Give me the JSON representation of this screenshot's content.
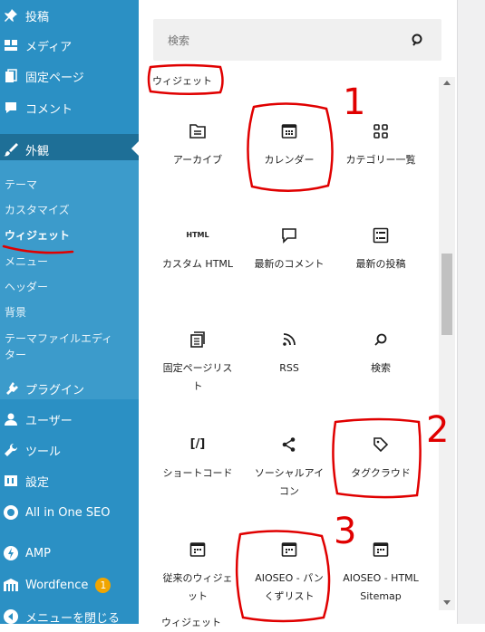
{
  "sidebar": {
    "items": [
      {
        "label": "投稿",
        "icon": "pin-icon"
      },
      {
        "label": "メディア",
        "icon": "media-icon"
      },
      {
        "label": "固定ページ",
        "icon": "pages-icon"
      },
      {
        "label": "コメント",
        "icon": "comment-icon"
      },
      {
        "label": "外観",
        "icon": "brush-icon"
      },
      {
        "label": "プラグイン",
        "icon": "plugin-icon"
      },
      {
        "label": "ユーザー",
        "icon": "user-icon"
      },
      {
        "label": "ツール",
        "icon": "wrench-icon"
      },
      {
        "label": "設定",
        "icon": "settings-icon"
      },
      {
        "label": "All in One SEO",
        "icon": "aioseo-icon"
      },
      {
        "label": "AMP",
        "icon": "amp-icon"
      },
      {
        "label": "Wordfence",
        "icon": "wordfence-icon",
        "badge": "1"
      },
      {
        "label": "メニューを閉じる",
        "icon": "collapse-icon"
      }
    ],
    "appearance_sub": [
      "テーマ",
      "カスタマイズ",
      "ウィジェット",
      "メニュー",
      "ヘッダー",
      "背景",
      "テーマファイルエディ",
      "ター"
    ]
  },
  "inserter": {
    "search_placeholder": "検索",
    "category": "ウィジェット",
    "blocks": [
      {
        "label": "アーカイブ",
        "icon": "archive-icon"
      },
      {
        "label": "カレンダー",
        "icon": "calendar-icon"
      },
      {
        "label": "カテゴリー一覧",
        "icon": "categories-icon"
      },
      {
        "label": "カスタム HTML",
        "icon": "html-icon",
        "icon_text": "HTML"
      },
      {
        "label": "最新のコメント",
        "icon": "latest-comments-icon"
      },
      {
        "label": "最新の投稿",
        "icon": "latest-posts-icon"
      },
      {
        "label": "固定ページリスト",
        "icon": "page-list-icon"
      },
      {
        "label": "RSS",
        "icon": "rss-icon"
      },
      {
        "label": "検索",
        "icon": "search-block-icon"
      },
      {
        "label": "ショートコード",
        "icon": "shortcode-icon",
        "icon_text": "[/]"
      },
      {
        "label": "ソーシャルアイコン",
        "icon": "share-icon"
      },
      {
        "label": "タグクラウド",
        "icon": "tag-icon"
      },
      {
        "label": "従来のウィジェット",
        "icon": "legacy-widget-icon"
      },
      {
        "label": "AIOSEO - パンくずリスト",
        "icon": "aioseo-breadcrumb-icon"
      },
      {
        "label": "AIOSEO - HTML Sitemap",
        "icon": "aioseo-sitemap-icon"
      }
    ],
    "next_category": "ウィジェット"
  },
  "annotations": {
    "n1": "1",
    "n2": "2",
    "n3": "3",
    "color": "#e00000"
  },
  "colors": {
    "sidebar": "#2b90c4",
    "active": "#1e6f97",
    "submenu": "#3c9bcb"
  }
}
